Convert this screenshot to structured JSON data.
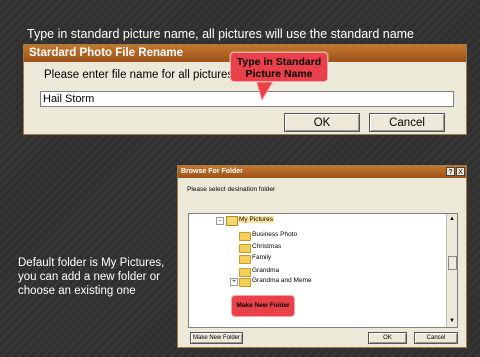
{
  "caption_top": "Type in standard picture name, all pictures will use the standard name",
  "rename_dialog": {
    "title": "Stardard Photo File Rename",
    "prompt": "Please enter file name for all pictures",
    "input_value": "Hail Storm",
    "ok_label": "OK",
    "cancel_label": "Cancel"
  },
  "callout_name": {
    "line1": "Type in Standard",
    "line2": "Picture Name"
  },
  "browse_dialog": {
    "title": "Browse For Folder",
    "help_label": "?",
    "close_label": "X",
    "prompt": "Please select desination folder",
    "tree_items": [
      {
        "label": "My Pictures",
        "expander": "−",
        "selected": true
      },
      {
        "label": "Business Photo"
      },
      {
        "label": "Christmas"
      },
      {
        "label": "Family"
      },
      {
        "label": "Grandma"
      },
      {
        "label": "Grandma and Meme",
        "expander": "+"
      }
    ],
    "new_folder_label": "Make New Folder",
    "ok_label": "OK",
    "cancel_label": "Cancel"
  },
  "callout_folder": "Make New Folder",
  "caption_side": "Default folder is My Pictures, you can add a new folder or choose an existing one",
  "colors": {
    "background": "#303030",
    "titlebar": "#b86828",
    "dialog": "#ece9d8",
    "callout": "#e9404a"
  },
  "icons": [
    "folder-icon",
    "my-pictures-icon",
    "scroll-up-icon",
    "scroll-down-icon",
    "expander-icon"
  ]
}
